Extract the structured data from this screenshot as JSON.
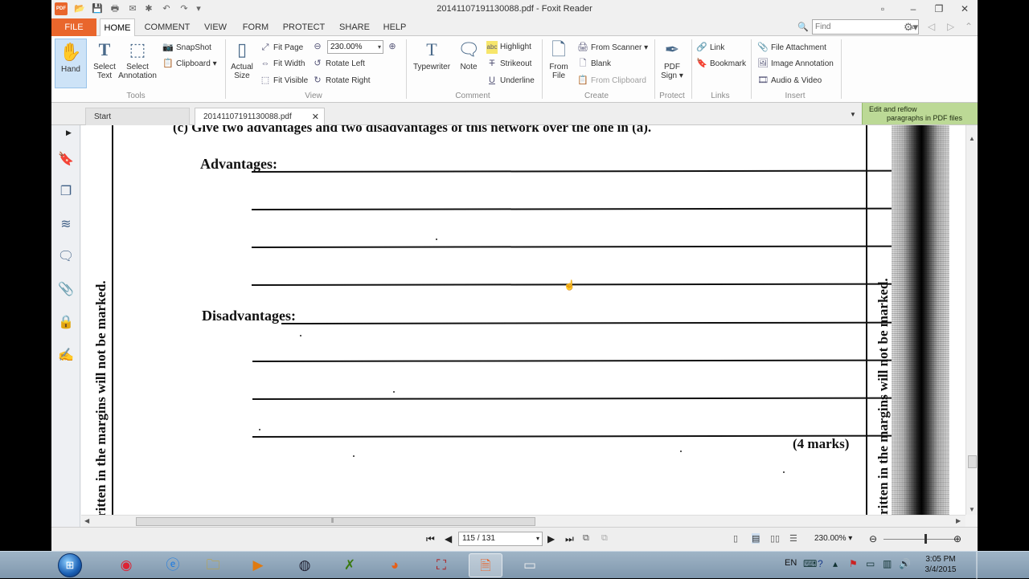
{
  "window": {
    "title": "20141107191130088.pdf - Foxit Reader",
    "app_icon_label": "PDF"
  },
  "menu_tabs": [
    "FILE",
    "HOME",
    "COMMENT",
    "VIEW",
    "FORM",
    "PROTECT",
    "SHARE",
    "HELP"
  ],
  "find": {
    "placeholder": "Find"
  },
  "ribbon": {
    "tools": {
      "label": "Tools",
      "hand": "Hand",
      "select_text_1": "Select",
      "select_text_2": "Text",
      "select_annot_1": "Select",
      "select_annot_2": "Annotation",
      "snapshot": "SnapShot",
      "clipboard": "Clipboard"
    },
    "view": {
      "label": "View",
      "actual_size_1": "Actual",
      "actual_size_2": "Size",
      "fit_page": "Fit Page",
      "fit_width": "Fit Width",
      "fit_visible": "Fit Visible",
      "zoom": "230.00%",
      "rotate_left": "Rotate Left",
      "rotate_right": "Rotate Right"
    },
    "comment": {
      "label": "Comment",
      "typewriter": "Typewriter",
      "note": "Note",
      "highlight": "Highlight",
      "strikeout": "Strikeout",
      "underline": "Underline"
    },
    "create": {
      "label": "Create",
      "from_file_1": "From",
      "from_file_2": "File",
      "from_scanner": "From Scanner",
      "blank": "Blank",
      "from_clipboard": "From Clipboard"
    },
    "protect": {
      "label": "Protect",
      "pdf_sign_1": "PDF",
      "pdf_sign_2": "Sign"
    },
    "links": {
      "label": "Links",
      "link": "Link",
      "bookmark": "Bookmark"
    },
    "insert": {
      "label": "Insert",
      "file_attachment": "File Attachment",
      "image_annotation": "Image Annotation",
      "audio_video": "Audio & Video"
    }
  },
  "doc_tabs": {
    "start": "Start",
    "current": "20141107191130088.pdf",
    "reflow_1": "Edit and reflow",
    "reflow_2": "paragraphs in PDF files"
  },
  "document": {
    "question": "(c)   Give two advantages and two disadvantages of this network over the one in (a).",
    "advantages_label": "Advantages:",
    "disadvantages_label": "Disadvantages:",
    "marks": "(4 marks)",
    "margin_left": "ritten in the margins will not be marked.",
    "margin_right": "ritten in the margins will not be marked."
  },
  "status": {
    "page": "115 / 131",
    "zoom": "230.00%"
  },
  "taskbar": {
    "apps": [
      "chrome-icon",
      "ie-icon",
      "explorer-icon",
      "media-player-icon",
      "qq-icon",
      "corel-icon",
      "firefox-icon",
      "acrobat-icon",
      "foxit-icon",
      "window-icon"
    ],
    "lang": "EN",
    "time": "3:05 PM",
    "date": "3/4/2015"
  }
}
